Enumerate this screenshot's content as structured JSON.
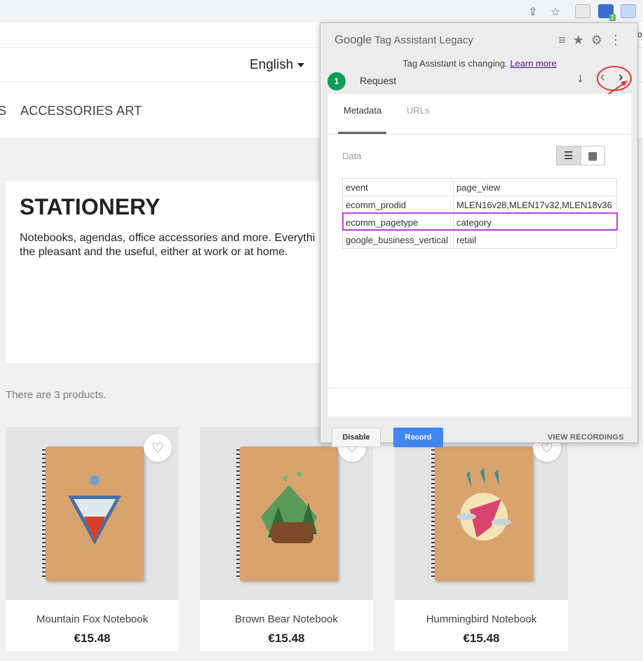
{
  "browser": {
    "share_icon": "share-icon",
    "bookmark_icon": "star-icon",
    "ext_badge": "2",
    "edge_text": "o"
  },
  "shop": {
    "language": "English",
    "nav": [
      "S",
      "ACCESSORIES",
      "ART"
    ],
    "category": {
      "title": "STATIONERY",
      "description_line1": "Notebooks, agendas, office accessories and more. Everythi",
      "description_line2": "the pleasant and the useful, either at work or at home."
    },
    "products_count": "There are 3 products.",
    "products": [
      {
        "name": "Mountain Fox Notebook",
        "price": "€15.48"
      },
      {
        "name": "Brown Bear Notebook",
        "price": "€15.48"
      },
      {
        "name": "Hummingbird Notebook",
        "price": "€15.48"
      }
    ]
  },
  "tag_assistant": {
    "brand": "Google",
    "title": "Tag Assistant Legacy",
    "notice_text": "Tag Assistant is changing.",
    "notice_link": "Learn more",
    "request_number": "1",
    "request_label": "Request",
    "tabs": [
      "Metadata",
      "URLs"
    ],
    "data_label": "Data",
    "rows": [
      {
        "key": "event",
        "value": "page_view"
      },
      {
        "key": "ecomm_prodid",
        "value": "MLEN16v28,MLEN17v32,MLEN18v36"
      },
      {
        "key": "ecomm_pagetype",
        "value": "category"
      },
      {
        "key": "google_business_vertical",
        "value": "retail"
      }
    ],
    "disable_label": "Disable",
    "record_label": "Record",
    "view_recordings_label": "VIEW RECORDINGS"
  },
  "colors": {
    "record_button": "#4285f4",
    "request_badge": "#0f9d58",
    "highlight": "#b845d8",
    "annotation": "#e53935"
  }
}
